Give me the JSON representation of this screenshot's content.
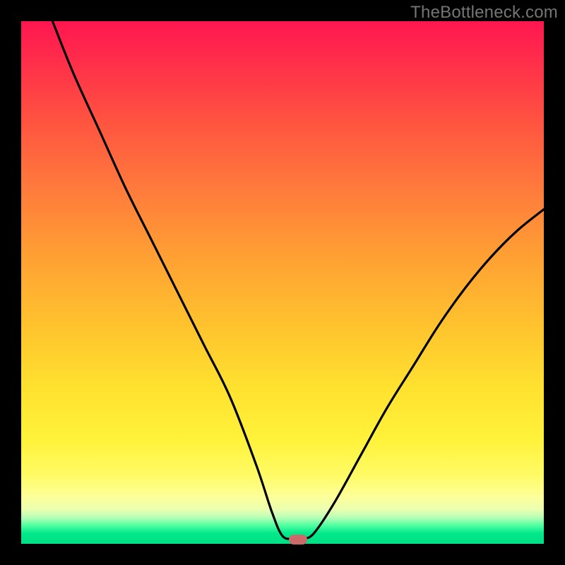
{
  "watermark": "TheBottleneck.com",
  "chart_data": {
    "type": "line",
    "title": "",
    "xlabel": "",
    "ylabel": "",
    "xlim": [
      0,
      100
    ],
    "ylim": [
      0,
      100
    ],
    "grid": false,
    "series": [
      {
        "name": "left-branch",
        "x": [
          6,
          10,
          15,
          20,
          25,
          30,
          35,
          40,
          45,
          48,
          50,
          52
        ],
        "y": [
          100,
          90,
          79,
          68,
          58,
          48,
          38,
          28,
          15,
          6,
          1.5,
          1
        ]
      },
      {
        "name": "right-branch",
        "x": [
          54,
          56,
          60,
          65,
          70,
          75,
          80,
          85,
          90,
          95,
          100
        ],
        "y": [
          1,
          2,
          8,
          17,
          26,
          34,
          42,
          49,
          55,
          60,
          64
        ]
      }
    ],
    "marker": {
      "x": 53,
      "y": 0.8,
      "color": "#cc6a6a"
    },
    "background_gradient": {
      "orientation": "vertical",
      "stops": [
        {
          "pos": 0.0,
          "color": "#ff1650"
        },
        {
          "pos": 0.45,
          "color": "#ffa033"
        },
        {
          "pos": 0.8,
          "color": "#fff23a"
        },
        {
          "pos": 0.95,
          "color": "#b6ffb6"
        },
        {
          "pos": 1.0,
          "color": "#00df84"
        }
      ]
    }
  }
}
